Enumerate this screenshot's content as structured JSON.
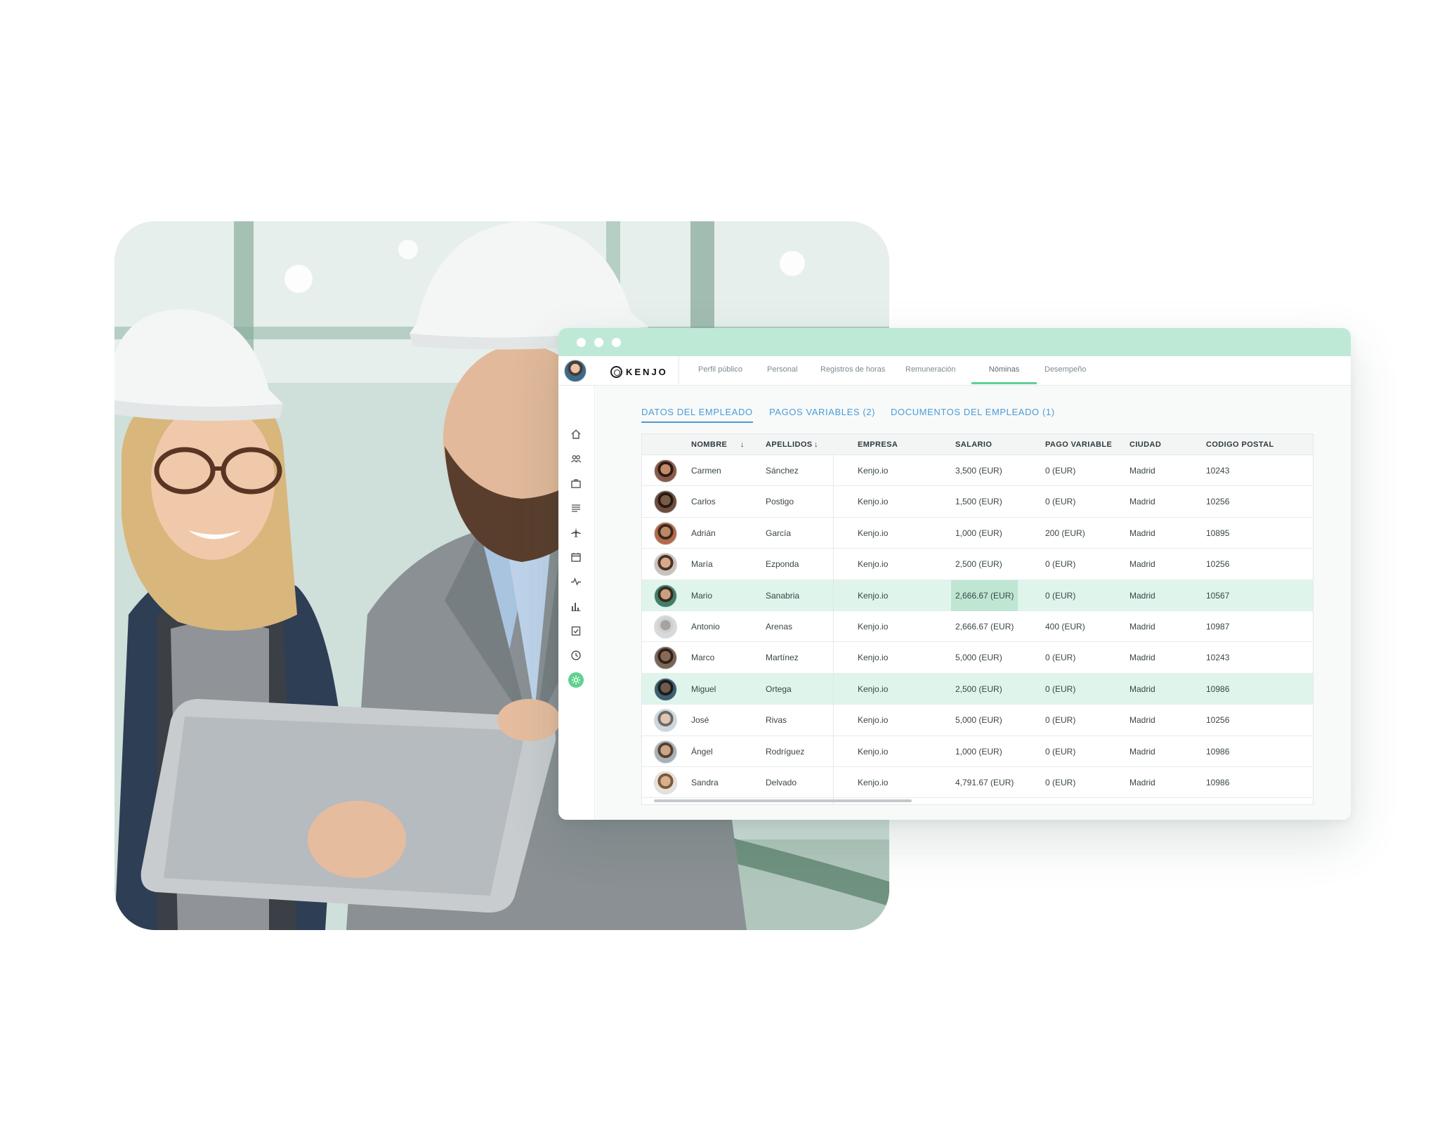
{
  "app": {
    "logo": "KENJO",
    "nav_tabs": [
      {
        "label": "Perfil público",
        "active": false
      },
      {
        "label": "Personal",
        "active": false
      },
      {
        "label": "Registros de horas",
        "active": false
      },
      {
        "label": "Remuneración",
        "active": false
      },
      {
        "label": "Nóminas",
        "active": true
      },
      {
        "label": "Desempeño",
        "active": false
      }
    ],
    "sidebar_icons": [
      "home-icon",
      "people-icon",
      "briefcase-icon",
      "list-icon",
      "plane-icon",
      "calendar-icon",
      "pulse-icon",
      "bar-chart-icon",
      "checklist-icon",
      "clock-icon",
      "settings-icon"
    ],
    "sub_tabs": [
      {
        "label": "DATOS DEL EMPLEADO",
        "active": true
      },
      {
        "label": "PAGOS VARIABLES (2)",
        "active": false
      },
      {
        "label": "DOCUMENTOS DEL EMPLEADO (1)",
        "active": false
      }
    ]
  },
  "table": {
    "headers": {
      "nombre": "NOMBRE",
      "apellidos": "APELLIDOS",
      "empresa": "EMPRESA",
      "salario": "SALARIO",
      "pago_variable": "PAGO VARIABLE",
      "ciudad": "CIUDAD",
      "codigo_postal": "CODIGO POSTAL"
    },
    "sort_arrow": "↓",
    "rows": [
      {
        "nombre": "Carmen",
        "apellidos": "Sánchez",
        "empresa": "Kenjo.io",
        "salario": "3,500 (EUR)",
        "pago_variable": "0 (EUR)",
        "ciudad": "Madrid",
        "codigo_postal": "10243"
      },
      {
        "nombre": "Carlos",
        "apellidos": "Postigo",
        "empresa": "Kenjo.io",
        "salario": "1,500 (EUR)",
        "pago_variable": "0 (EUR)",
        "ciudad": "Madrid",
        "codigo_postal": "10256"
      },
      {
        "nombre": "Adrián",
        "apellidos": "García",
        "empresa": "Kenjo.io",
        "salario": "1,000 (EUR)",
        "pago_variable": "200 (EUR)",
        "ciudad": "Madrid",
        "codigo_postal": "10895"
      },
      {
        "nombre": "María",
        "apellidos": "Ezponda",
        "empresa": "Kenjo.io",
        "salario": "2,500 (EUR)",
        "pago_variable": "0 (EUR)",
        "ciudad": "Madrid",
        "codigo_postal": "10256"
      },
      {
        "nombre": "Mario",
        "apellidos": "Sanabria",
        "empresa": "Kenjo.io",
        "salario": "2,666.67 (EUR)",
        "pago_variable": "0 (EUR)",
        "ciudad": "Madrid",
        "codigo_postal": "10567"
      },
      {
        "nombre": "Antonio",
        "apellidos": "Arenas",
        "empresa": "Kenjo.io",
        "salario": "2,666.67 (EUR)",
        "pago_variable": "400 (EUR)",
        "ciudad": "Madrid",
        "codigo_postal": "10987"
      },
      {
        "nombre": "Marco",
        "apellidos": "Martínez",
        "empresa": "Kenjo.io",
        "salario": "5,000 (EUR)",
        "pago_variable": "0 (EUR)",
        "ciudad": "Madrid",
        "codigo_postal": "10243"
      },
      {
        "nombre": "Miguel",
        "apellidos": "Ortega",
        "empresa": "Kenjo.io",
        "salario": "2,500 (EUR)",
        "pago_variable": "0 (EUR)",
        "ciudad": "Madrid",
        "codigo_postal": "10986"
      },
      {
        "nombre": "José",
        "apellidos": "Rivas",
        "empresa": "Kenjo.io",
        "salario": "5,000 (EUR)",
        "pago_variable": "0 (EUR)",
        "ciudad": "Madrid",
        "codigo_postal": "10256"
      },
      {
        "nombre": "Ángel",
        "apellidos": "Rodríguez",
        "empresa": "Kenjo.io",
        "salario": "1,000 (EUR)",
        "pago_variable": "0 (EUR)",
        "ciudad": "Madrid",
        "codigo_postal": "10986"
      },
      {
        "nombre": "Sandra",
        "apellidos": "Delvado",
        "empresa": "Kenjo.io",
        "salario": "4,791.67 (EUR)",
        "pago_variable": "0 (EUR)",
        "ciudad": "Madrid",
        "codigo_postal": "10986"
      }
    ]
  },
  "colors": {
    "accent_green": "#5fd192",
    "titlebar": "#bfe9d7",
    "row_highlight": "#dff5eb",
    "link_blue": "#4b9bd6"
  }
}
